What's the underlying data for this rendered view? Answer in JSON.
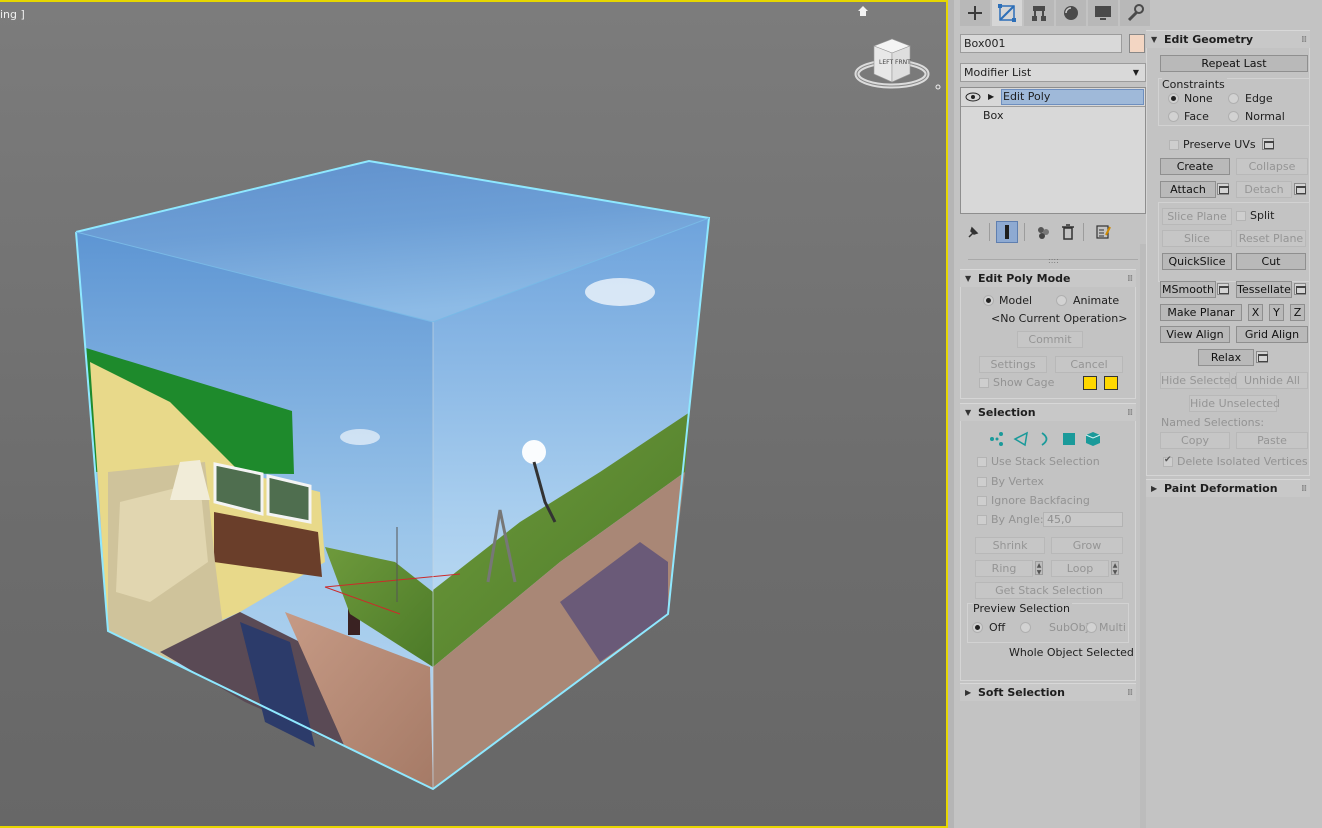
{
  "viewport": {
    "label": "ing ]",
    "viewcube_left": "LEFT",
    "viewcube_front": "FRNT"
  },
  "colors": {
    "viewport_border": "#e7d700",
    "selection_edges": "#8fe8ff",
    "object_color": "#f3d6c3",
    "cage_colors": [
      "#ffd800",
      "#ffd800"
    ]
  },
  "tabs": [
    {
      "icon": "plus-icon",
      "name": "Create"
    },
    {
      "icon": "modify-icon",
      "name": "Modify"
    },
    {
      "icon": "hierarchy-icon",
      "name": "Hierarchy"
    },
    {
      "icon": "motion-icon",
      "name": "Motion"
    },
    {
      "icon": "display-icon",
      "name": "Display"
    },
    {
      "icon": "utilities-icon",
      "name": "Utilities"
    }
  ],
  "object": {
    "name": "Box001"
  },
  "modifier_list": {
    "label": "Modifier List"
  },
  "stack": [
    {
      "label": "Edit Poly",
      "selected": true
    },
    {
      "label": "Box",
      "selected": false
    }
  ],
  "edit_poly_mode": {
    "title": "Edit Poly Mode",
    "model": "Model",
    "animate": "Animate",
    "current_op": "<No Current Operation>",
    "commit": "Commit",
    "settings": "Settings",
    "cancel": "Cancel",
    "show_cage": "Show Cage"
  },
  "selection": {
    "title": "Selection",
    "use_stack": "Use Stack Selection",
    "by_vertex": "By Vertex",
    "ignore_backfacing": "Ignore Backfacing",
    "by_angle": "By Angle:",
    "angle_value": "45,0",
    "shrink": "Shrink",
    "grow": "Grow",
    "ring": "Ring",
    "loop": "Loop",
    "get_stack": "Get Stack Selection",
    "preview_title": "Preview Selection",
    "off": "Off",
    "subobj": "SubObj",
    "multi": "Multi",
    "status": "Whole Object Selected"
  },
  "soft_selection": {
    "title": "Soft Selection"
  },
  "edit_geometry": {
    "title": "Edit Geometry",
    "repeat_last": "Repeat Last",
    "constraints": "Constraints",
    "none": "None",
    "edge": "Edge",
    "face": "Face",
    "normal": "Normal",
    "preserve_uvs": "Preserve UVs",
    "create": "Create",
    "collapse": "Collapse",
    "attach": "Attach",
    "detach": "Detach",
    "slice_plane": "Slice Plane",
    "split": "Split",
    "slice": "Slice",
    "reset_plane": "Reset Plane",
    "quickslice": "QuickSlice",
    "cut": "Cut",
    "msmooth": "MSmooth",
    "tessellate": "Tessellate",
    "make_planar": "Make Planar",
    "x": "X",
    "y": "Y",
    "z": "Z",
    "view_align": "View Align",
    "grid_align": "Grid Align",
    "relax": "Relax",
    "hide_selected": "Hide Selected",
    "unhide_all": "Unhide All",
    "hide_unselected": "Hide Unselected",
    "named_selections": "Named Selections:",
    "copy": "Copy",
    "paste": "Paste",
    "delete_isolated": "Delete Isolated Vertices"
  },
  "paint_deformation": {
    "title": "Paint Deformation"
  }
}
